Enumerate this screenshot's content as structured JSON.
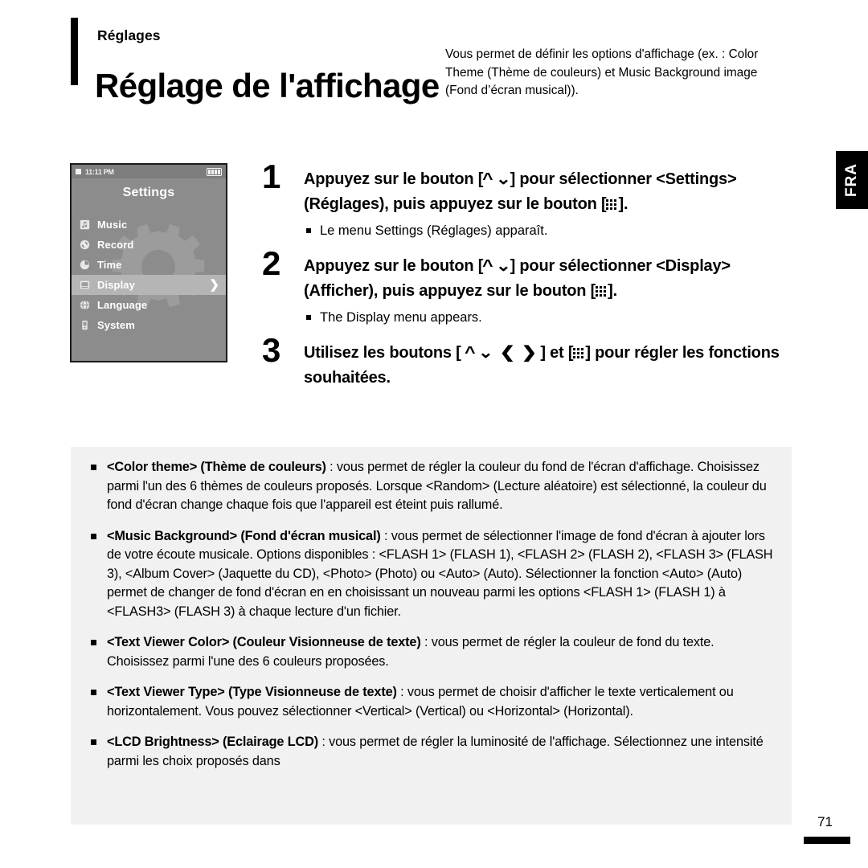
{
  "header": {
    "kicker": "Réglages",
    "title": "Réglage de l'affichage",
    "description": "Vous permet de définir les options d'affichage (ex. : Color Theme (Thème de couleurs) et Music Background image (Fond d’écran musical))."
  },
  "side_tab": {
    "label": "FRA"
  },
  "device": {
    "status_time": "11:11 PM",
    "battery_icon": "battery-full-icon",
    "screen_title": "Settings",
    "menu_items": [
      {
        "label": "Music",
        "icon": "music-note-icon",
        "selected": false,
        "has_arrow": false
      },
      {
        "label": "Record",
        "icon": "record-icon",
        "selected": false,
        "has_arrow": false
      },
      {
        "label": "Time",
        "icon": "clock-icon",
        "selected": false,
        "has_arrow": false
      },
      {
        "label": "Display",
        "icon": "monitor-icon",
        "selected": true,
        "has_arrow": true
      },
      {
        "label": "Language",
        "icon": "globe-icon",
        "selected": false,
        "has_arrow": false
      },
      {
        "label": "System",
        "icon": "device-icon",
        "selected": false,
        "has_arrow": false
      }
    ],
    "arrow_glyph": "❯",
    "background_watermark": "gear-watermark"
  },
  "steps": [
    {
      "number": "1",
      "text_before_nav": "Appuyez sur le bouton [",
      "text_after_nav": "] pour sélectionner <Settings> (Réglages), puis appuyez sur le bouton [",
      "text_end": "].",
      "note": "Le menu Settings (Réglages) apparaît."
    },
    {
      "number": "2",
      "text_before_nav": "Appuyez sur le bouton [",
      "text_after_nav": "] pour sélectionner <Display> (Afficher), puis appuyez sur le bouton [",
      "text_end": "].",
      "note": "The Display menu appears."
    },
    {
      "number": "3",
      "text_before_nav": "Utilisez les boutons [",
      "text_after_nav": "] et [",
      "text_end": "] pour régler les fonctions souhaitées.",
      "note": ""
    }
  ],
  "glyphs": {
    "chevron_up": "⌃",
    "chevron_down": "⌄",
    "chevron_left": "❮",
    "chevron_right": "❯",
    "grid_button": "grid-3x3-icon"
  },
  "details": [
    {
      "term": "<Color theme> (Thème de couleurs)",
      "body": " : vous permet de régler la couleur du fond de l'écran d'affichage. Choisissez parmi l'un des 6 thèmes de couleurs proposés. Lorsque <Random> (Lecture aléatoire) est sélectionné, la couleur du fond d'écran change chaque fois que l'appareil est éteint puis rallumé."
    },
    {
      "term": "<Music Background> (Fond d'écran musical)",
      "body": " : vous permet de sélectionner l'image de fond d'écran à ajouter lors de votre écoute musicale. Options disponibles : <FLASH 1> (FLASH 1), <FLASH 2> (FLASH 2), <FLASH 3> (FLASH 3), <Album Cover> (Jaquette du CD), <Photo> (Photo) ou <Auto> (Auto). Sélectionner la fonction <Auto> (Auto) permet de changer de fond d'écran en en choisissant un nouveau parmi les options <FLASH 1> (FLASH 1) à <FLASH3> (FLASH 3) à chaque lecture d'un fichier."
    },
    {
      "term": "<Text Viewer Color> (Couleur Visionneuse de texte)",
      "body": " : vous permet de régler la couleur de fond du texte. Choisissez parmi l'une des 6 couleurs proposées."
    },
    {
      "term": "<Text Viewer Type> (Type Visionneuse de texte)",
      "body": " : vous permet de choisir d'afficher le texte verticalement ou horizontalement. Vous pouvez sélectionner <Vertical> (Vertical) ou <Horizontal> (Horizontal)."
    },
    {
      "term": "<LCD Brightness> (Eclairage LCD)",
      "body": " : vous permet de régler la luminosité de l'affichage. Sélectionnez une intensité parmi les choix proposés dans"
    }
  ],
  "footer": {
    "page_number": "71"
  },
  "colors": {
    "ink": "#000000",
    "detail_box_bg": "#f1f1f1",
    "device_bg": "#8c8c8c",
    "device_selected_bg": "#b5b5b5",
    "device_text": "#ffffff"
  }
}
